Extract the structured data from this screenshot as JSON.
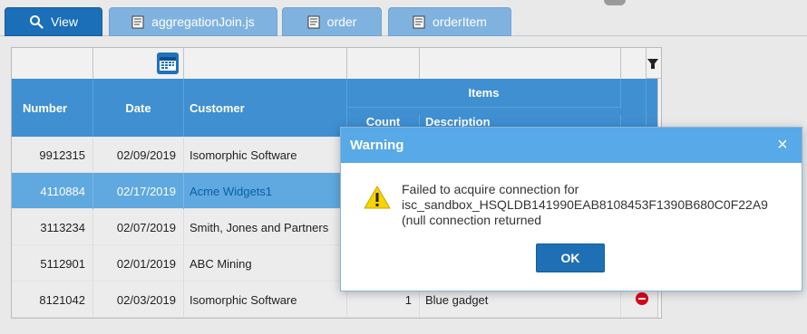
{
  "tabs": [
    {
      "label": "View",
      "icon": "search-icon",
      "active": true
    },
    {
      "label": "aggregationJoin.js",
      "icon": "document-icon",
      "active": false
    },
    {
      "label": "order",
      "icon": "document-icon",
      "active": false
    },
    {
      "label": "orderItem",
      "icon": "document-icon",
      "active": false
    }
  ],
  "grid": {
    "headers": {
      "number": "Number",
      "date": "Date",
      "customer": "Customer",
      "items": "Items",
      "count": "Count",
      "description": "Description"
    },
    "rows": [
      {
        "number": "9912315",
        "date": "02/09/2019",
        "customer": "Isomorphic Software",
        "count": "",
        "description": ""
      },
      {
        "number": "4110884",
        "date": "02/17/2019",
        "customer": "Acme Widgets1",
        "count": "",
        "description": ""
      },
      {
        "number": "3113234",
        "date": "02/07/2019",
        "customer": "Smith, Jones and Partners",
        "count": "",
        "description": ""
      },
      {
        "number": "5112901",
        "date": "02/01/2019",
        "customer": "ABC Mining",
        "count": "",
        "description": ""
      },
      {
        "number": "8121042",
        "date": "02/03/2019",
        "customer": "Isomorphic Software",
        "count": "1",
        "description": "Blue gadget"
      }
    ]
  },
  "dialog": {
    "title": "Warning",
    "close": "×",
    "message_line1": "Failed to acquire connection for",
    "message_line2": "isc_sandbox_HSQLDB141990EAB8108453F1390B680C0F22A9",
    "message_line3": "(null connection returned",
    "ok_label": "OK"
  },
  "colors": {
    "tab_active": "#1a6fb8",
    "tab_inactive": "#7fb2df",
    "header_bg": "#3f8fd1",
    "selected_row": "#5fa8e0",
    "dialog_header": "#57a9e7",
    "ok_button": "#1f6fb5"
  }
}
